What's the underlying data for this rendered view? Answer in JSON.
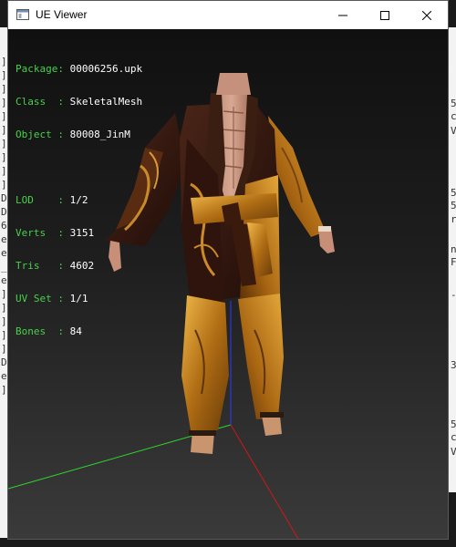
{
  "window": {
    "title": "UE Viewer"
  },
  "info": {
    "package": {
      "label": "Package",
      "value": "00006256.upk"
    },
    "class": {
      "label": "Class  ",
      "value": "SkeletalMesh"
    },
    "object": {
      "label": "Object ",
      "value": "80008_JinM"
    },
    "lod": {
      "label": "LOD    ",
      "value": "1/2"
    },
    "verts": {
      "label": "Verts  ",
      "value": "3151"
    },
    "tris": {
      "label": "Tris   ",
      "value": "4602"
    },
    "uvset": {
      "label": "UV Set ",
      "value": "1/1"
    },
    "bones": {
      "label": "Bones  ",
      "value": "84"
    }
  },
  "colors": {
    "label_green": "#47d14a",
    "value_white": "#ffffff",
    "axis_x_red": "#d01818",
    "axis_y_green": "#2ed62e",
    "axis_z_blue": "#2a3cff"
  },
  "background_glyphs": {
    "left": [
      "]",
      "]",
      "]",
      "]",
      "]",
      "]",
      "]",
      "]",
      "]",
      "]",
      "D",
      "D",
      "6",
      "e",
      "e",
      "_",
      "e",
      "]",
      "]",
      "]",
      "]",
      "]",
      "D",
      "e",
      "]"
    ],
    "right": [
      "5",
      "c",
      "V",
      "5",
      "5",
      "r",
      "n",
      "F",
      "-",
      "3",
      "5",
      "c",
      "V"
    ]
  },
  "icons": {
    "app": "window-app-icon",
    "minimize": "minimize-icon",
    "maximize": "maximize-icon",
    "close": "close-icon"
  }
}
